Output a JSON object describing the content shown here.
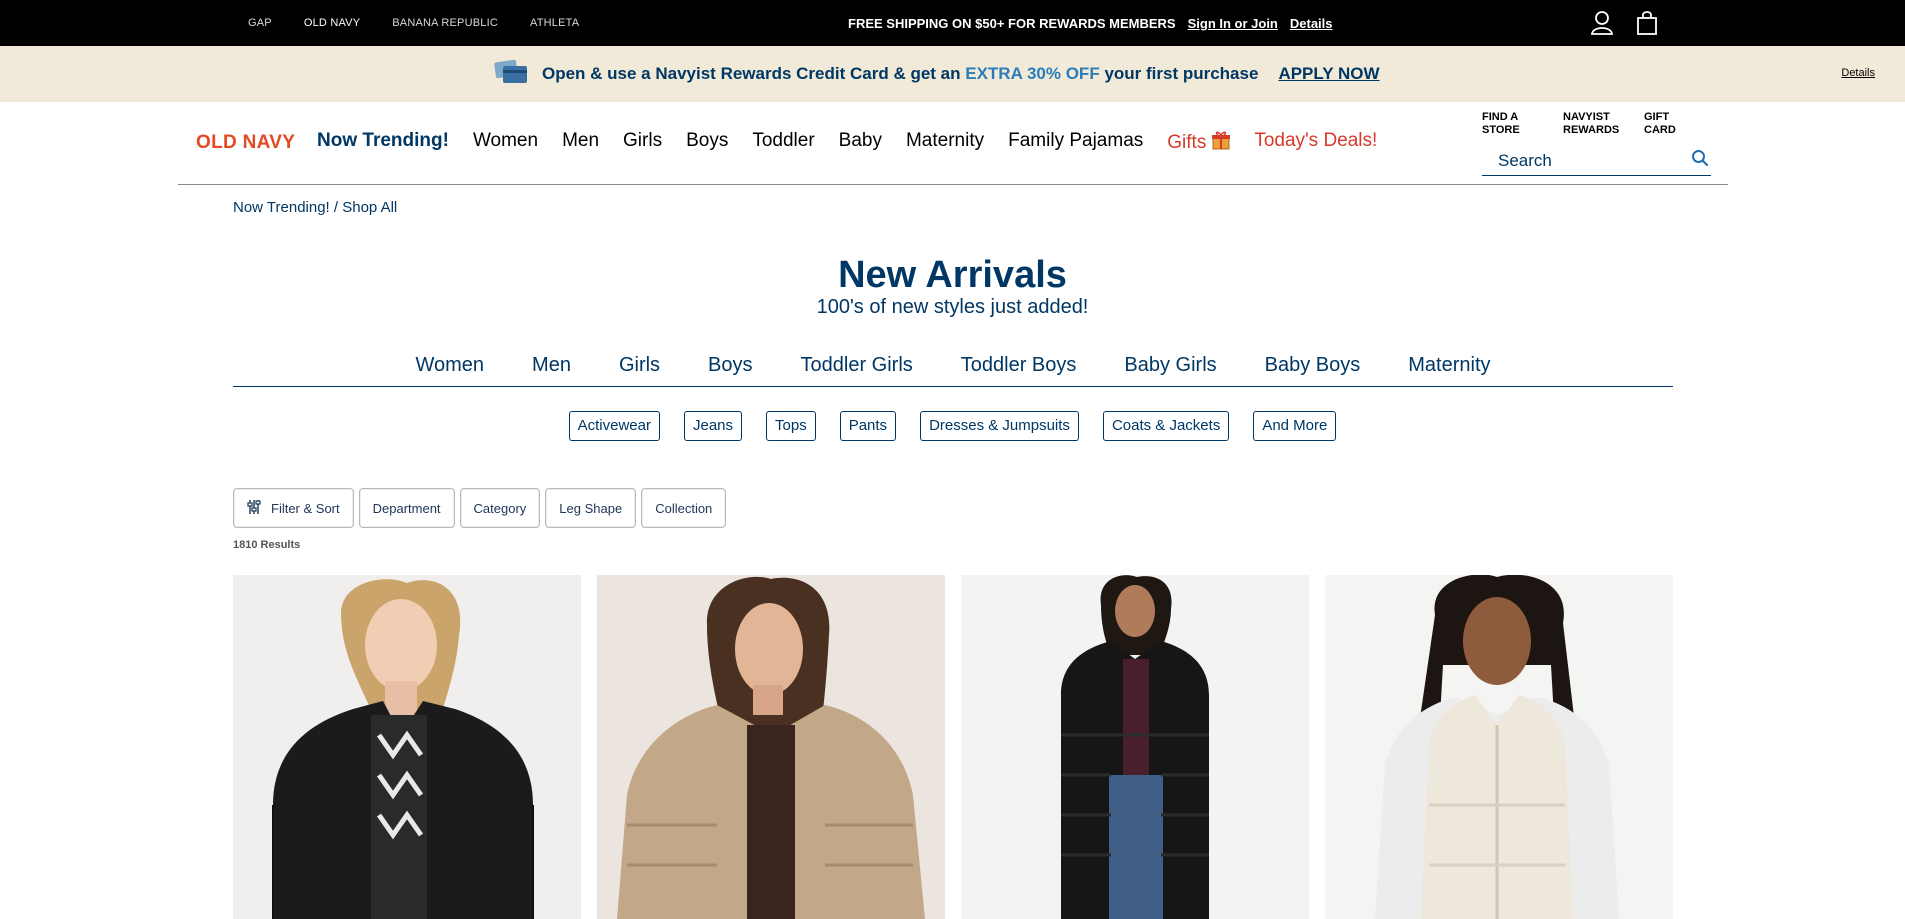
{
  "topbar": {
    "brands": [
      {
        "label": "GAP",
        "active": false
      },
      {
        "label": "OLD NAVY",
        "active": true
      },
      {
        "label": "BANANA REPUBLIC",
        "active": false
      },
      {
        "label": "ATHLETA",
        "active": false
      }
    ],
    "promo_text": "FREE SHIPPING ON $50+ FOR REWARDS MEMBERS",
    "sign_in_label": "Sign In or Join",
    "details_label": "Details",
    "icons": [
      "account-icon",
      "bag-icon"
    ]
  },
  "rewards_banner": {
    "text_before": "Open & use a Navyist Rewards Credit Card & get an",
    "highlight": "EXTRA 30% OFF",
    "text_after": "your first purchase",
    "cta": "APPLY NOW",
    "details_label": "Details",
    "highlight_color": "#2a7db8",
    "background": "#f2ead9"
  },
  "header": {
    "logo": "OLD NAVY",
    "logo_color": "#e34a24",
    "menu": {
      "trending": "Now Trending!",
      "women": "Women",
      "men": "Men",
      "girls": "Girls",
      "boys": "Boys",
      "toddler": "Toddler",
      "baby": "Baby",
      "maternity": "Maternity",
      "family_pajamas": "Family Pajamas",
      "gifts": "Gifts",
      "deals": "Today's Deals!"
    },
    "quick_links": {
      "find_store": "FIND A STORE",
      "navyist_rewards": "NAVYIST REWARDS",
      "gift_card": "GIFT CARD"
    },
    "search_placeholder": "Search"
  },
  "breadcrumb": "Now Trending! / Shop All",
  "page": {
    "title": "New Arrivals",
    "subtitle": "100's of new styles just added!"
  },
  "departments": [
    "Women",
    "Men",
    "Girls",
    "Boys",
    "Toddler Girls",
    "Toddler Boys",
    "Baby Girls",
    "Baby Boys",
    "Maternity"
  ],
  "categories": [
    "Activewear",
    "Jeans",
    "Tops",
    "Pants",
    "Dresses & Jumpsuits",
    "Coats & Jackets",
    "And More"
  ],
  "filters": {
    "filter_sort": "Filter & Sort",
    "department": "Department",
    "category": "Category",
    "leg_shape": "Leg Shape",
    "collection": "Collection"
  },
  "results_count": "1810 Results",
  "products": [
    {
      "name": "black puffer jacket",
      "colors": {
        "bg": "#f1efee",
        "garment": "#1b1b1d"
      }
    },
    {
      "name": "tan puffer jacket",
      "colors": {
        "bg": "#ece4df",
        "garment": "#c2a889"
      }
    },
    {
      "name": "black long puffer coat",
      "colors": {
        "bg": "#f3f3f3",
        "garment": "#161616"
      }
    },
    {
      "name": "cream puffer vest",
      "colors": {
        "bg": "#f4f4f3",
        "garment": "#ede7dc"
      }
    }
  ]
}
